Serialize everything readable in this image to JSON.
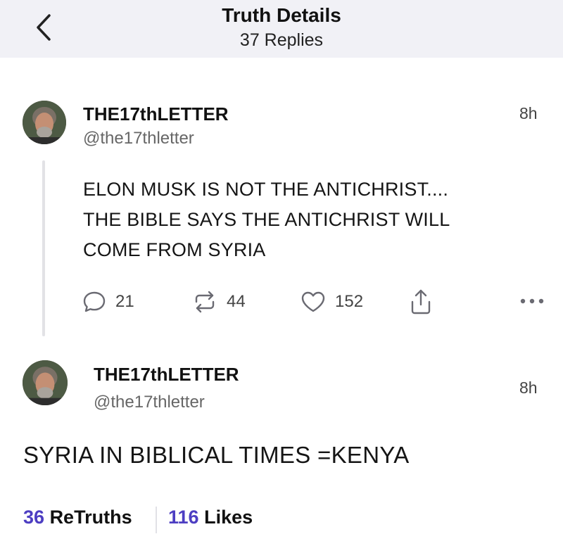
{
  "header": {
    "title": "Truth Details",
    "subtitle": "37 Replies"
  },
  "post": {
    "display_name": "THE17thLETTER",
    "handle": "@the17thletter",
    "time": "8h",
    "lines": [
      "ELON MUSK IS NOT THE ANTICHRIST....",
      "THE BIBLE SAYS THE ANTICHRIST WILL",
      "COME FROM SYRIA"
    ],
    "actions": {
      "replies": "21",
      "retruths": "44",
      "likes": "152"
    }
  },
  "reply": {
    "display_name": "THE17thLETTER",
    "handle": "@the17thletter",
    "time": "8h",
    "text": "SYRIA IN BIBLICAL TIMES =KENYA"
  },
  "stats": {
    "retruths_count": "36",
    "retruths_label": "ReTruths",
    "likes_count": "116",
    "likes_label": "Likes"
  },
  "icons": {
    "back": "chevron-left-icon",
    "reply": "speech-bubble-icon",
    "retruth": "repost-arrows-icon",
    "like": "heart-icon",
    "share": "share-icon",
    "more": "ellipsis-icon"
  },
  "colors": {
    "header_bg": "#f1f1f6",
    "accent": "#4d3ec2",
    "icon_gray": "#6a6a72"
  }
}
